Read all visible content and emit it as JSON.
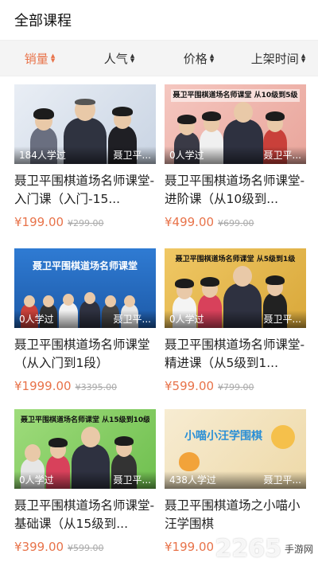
{
  "header": {
    "title": "全部课程"
  },
  "sort": [
    {
      "label": "销量",
      "active": true
    },
    {
      "label": "人气",
      "active": false
    },
    {
      "label": "价格",
      "active": false
    },
    {
      "label": "上架时间",
      "active": false
    }
  ],
  "courses": [
    {
      "learners": "184人学过",
      "teacher": "聂卫平...",
      "title": "聂卫平围棋道场名师课堂-入门课（入门-15...",
      "price": "¥199.00",
      "original_price": "¥299.00",
      "banner": "",
      "bg": "#dfe6ef"
    },
    {
      "learners": "0人学过",
      "teacher": "聂卫平...",
      "title": "聂卫平围棋道场名师课堂-进阶课（从10级到...",
      "price": "¥499.00",
      "original_price": "¥699.00",
      "banner": "聂卫平围棋道场名师课堂 从10级到5级",
      "bg": "#f1b8b0"
    },
    {
      "learners": "0人学过",
      "teacher": "聂卫平...",
      "title": "聂卫平围棋道场名师课堂（从入门到1段）",
      "price": "¥1999.00",
      "original_price": "¥3395.00",
      "banner": "聂卫平围棋道场名师课堂",
      "bg": "#2e74c9"
    },
    {
      "learners": "0人学过",
      "teacher": "聂卫平...",
      "title": "聂卫平围棋道场名师课堂-精进课（从5级到1...",
      "price": "¥599.00",
      "original_price": "¥799.00",
      "banner": "聂卫平围棋道场名师课堂 从5级到1级",
      "bg": "#e8be4e"
    },
    {
      "learners": "0人学过",
      "teacher": "聂卫平...",
      "title": "聂卫平围棋道场名师课堂-基础课（从15级到...",
      "price": "¥399.00",
      "original_price": "¥599.00",
      "banner": "聂卫平围棋道场名师课堂 从15级到10级",
      "bg": "#8dcf6a"
    },
    {
      "learners": "438人学过",
      "teacher": "聂卫平...",
      "title": "聂卫平围棋道场之小喵小汪学围棋",
      "price": "¥199.00",
      "original_price": "",
      "banner": "小喵小汪学围棋",
      "bg": "#f3e7c9"
    }
  ],
  "watermark": {
    "brand": "2265",
    "sub": "手游网"
  },
  "colors": {
    "accent": "#e8734a",
    "sortbar_bg": "#f4f4f4"
  }
}
